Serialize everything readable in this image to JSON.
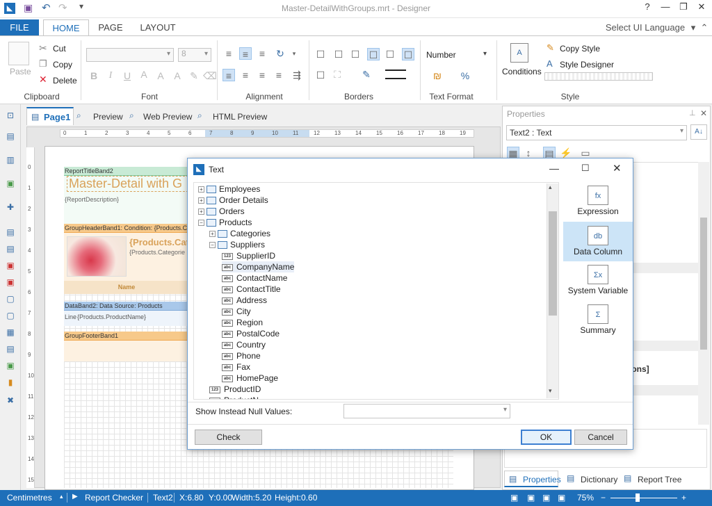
{
  "window": {
    "title": "Master-DetailWithGroups.mrt - Designer",
    "controls": [
      "?",
      "—",
      "❐",
      "✕"
    ]
  },
  "ribbon_tabs": [
    "FILE",
    "HOME",
    "PAGE",
    "LAYOUT"
  ],
  "select_ui_language": "Select UI Language",
  "clipboard": {
    "paste": "Paste",
    "cut": "Cut",
    "copy": "Copy",
    "delete": "Delete",
    "label": "Clipboard"
  },
  "font": {
    "size": "8",
    "label": "Font"
  },
  "alignment": {
    "label": "Alignment"
  },
  "borders": {
    "label": "Borders"
  },
  "text_format": {
    "value": "Number",
    "label": "Text Format"
  },
  "style": {
    "conditions": "Conditions",
    "copy_style": "Copy Style",
    "style_designer": "Style Designer",
    "label": "Style"
  },
  "doc_tabs": {
    "page": "Page1",
    "preview": "Preview",
    "web_preview": "Web Preview",
    "html_preview": "HTML Preview"
  },
  "ruler_h": [
    "0",
    "1",
    "2",
    "3",
    "4",
    "5",
    "6",
    "7",
    "8",
    "9",
    "10",
    "11",
    "12",
    "13",
    "14",
    "15",
    "16",
    "17",
    "18",
    "19"
  ],
  "ruler_v": [
    "0",
    "1",
    "2",
    "3",
    "4",
    "5",
    "6",
    "7",
    "8",
    "9",
    "10",
    "11",
    "12",
    "13",
    "14",
    "15"
  ],
  "bands": {
    "report_title": "ReportTitleBand2",
    "title_text": "Master-Detail with G",
    "report_description": "{ReportDescription}",
    "group_header": "GroupHeaderBand1: Condition: {Products.Ca",
    "products_cat": "{Products.Cat",
    "products_categories": "{Products.Categorie",
    "name_col": "Name",
    "data_band": "DataBand2: Data Source: Products",
    "line_text": "Line",
    "product_name": "{Products.ProductName}",
    "group_footer": "GroupFooterBand1"
  },
  "properties": {
    "title": "Properties",
    "selected": "Text2 : Text",
    "partial": "ions]",
    "bottom_tabs": [
      "Properties",
      "Dictionary",
      "Report Tree"
    ]
  },
  "dialog": {
    "title": "Text",
    "tree": [
      {
        "label": "Employees",
        "level": 0,
        "type": "table",
        "exp": "+"
      },
      {
        "label": "Order Details",
        "level": 0,
        "type": "table",
        "exp": "+"
      },
      {
        "label": "Orders",
        "level": 0,
        "type": "table",
        "exp": "+"
      },
      {
        "label": "Products",
        "level": 0,
        "type": "table",
        "exp": "−"
      },
      {
        "label": "Categories",
        "level": 1,
        "type": "relation",
        "exp": "+"
      },
      {
        "label": "Suppliers",
        "level": 1,
        "type": "relation",
        "exp": "−"
      },
      {
        "label": "SupplierID",
        "level": 2,
        "type": "int"
      },
      {
        "label": "CompanyName",
        "level": 2,
        "type": "abc",
        "hl": true
      },
      {
        "label": "ContactName",
        "level": 2,
        "type": "abc"
      },
      {
        "label": "ContactTitle",
        "level": 2,
        "type": "abc"
      },
      {
        "label": "Address",
        "level": 2,
        "type": "abc"
      },
      {
        "label": "City",
        "level": 2,
        "type": "abc"
      },
      {
        "label": "Region",
        "level": 2,
        "type": "abc"
      },
      {
        "label": "PostalCode",
        "level": 2,
        "type": "abc"
      },
      {
        "label": "Country",
        "level": 2,
        "type": "abc"
      },
      {
        "label": "Phone",
        "level": 2,
        "type": "abc"
      },
      {
        "label": "Fax",
        "level": 2,
        "type": "abc"
      },
      {
        "label": "HomePage",
        "level": 2,
        "type": "abc"
      },
      {
        "label": "ProductID",
        "level": 1,
        "type": "int"
      },
      {
        "label": "ProductN",
        "level": 1,
        "type": "abc"
      }
    ],
    "type_badges": {
      "int": "123",
      "abc": "abc"
    },
    "right_buttons": [
      {
        "label": "Expression",
        "icon": "fx"
      },
      {
        "label": "Data Column",
        "icon": "db",
        "selected": true
      },
      {
        "label": "System Variable",
        "icon": "Σx"
      },
      {
        "label": "Summary",
        "icon": "Σ"
      }
    ],
    "null_label": "Show Instead Null Values:",
    "check": "Check",
    "ok": "OK",
    "cancel": "Cancel"
  },
  "status": {
    "units": "Centimetres",
    "report_checker": "Report Checker",
    "component": "Text2",
    "x": "X:6.80",
    "y": "Y:0.00",
    "width": "Width:5.20",
    "height": "Height:0.60",
    "zoom": "75%",
    "zoom_level": 0.75
  },
  "colors": {
    "accent": "#1e6fb9",
    "band_title": "#7fc9a0",
    "band_group": "#f0a850",
    "band_data": "#7fa9d8"
  }
}
